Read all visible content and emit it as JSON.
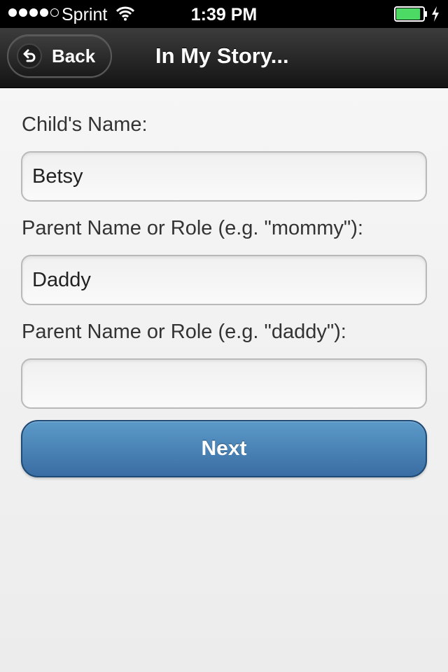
{
  "status_bar": {
    "carrier": "Sprint",
    "time": "1:39 PM",
    "signal_bars_filled": 4,
    "signal_bars_total": 5,
    "battery_level": 0.9,
    "battery_color": "#4cd964",
    "icons": [
      "wifi-icon",
      "battery-icon",
      "charge-icon"
    ]
  },
  "nav_bar": {
    "back_label": "Back",
    "back_icon": "back-arrow-icon",
    "title": "In My Story..."
  },
  "form": {
    "child_name": {
      "label": "Child's Name:",
      "value": "Betsy"
    },
    "parent_one": {
      "label": "Parent Name or Role (e.g. \"mommy\"):",
      "value": "Daddy"
    },
    "parent_two": {
      "label": "Parent Name or Role (e.g. \"daddy\"):",
      "value": ""
    },
    "next_label": "Next"
  },
  "colors": {
    "nav_bar": "#1e1e1e",
    "primary_button": "#4a84b8",
    "background": "#f2f2f2"
  }
}
